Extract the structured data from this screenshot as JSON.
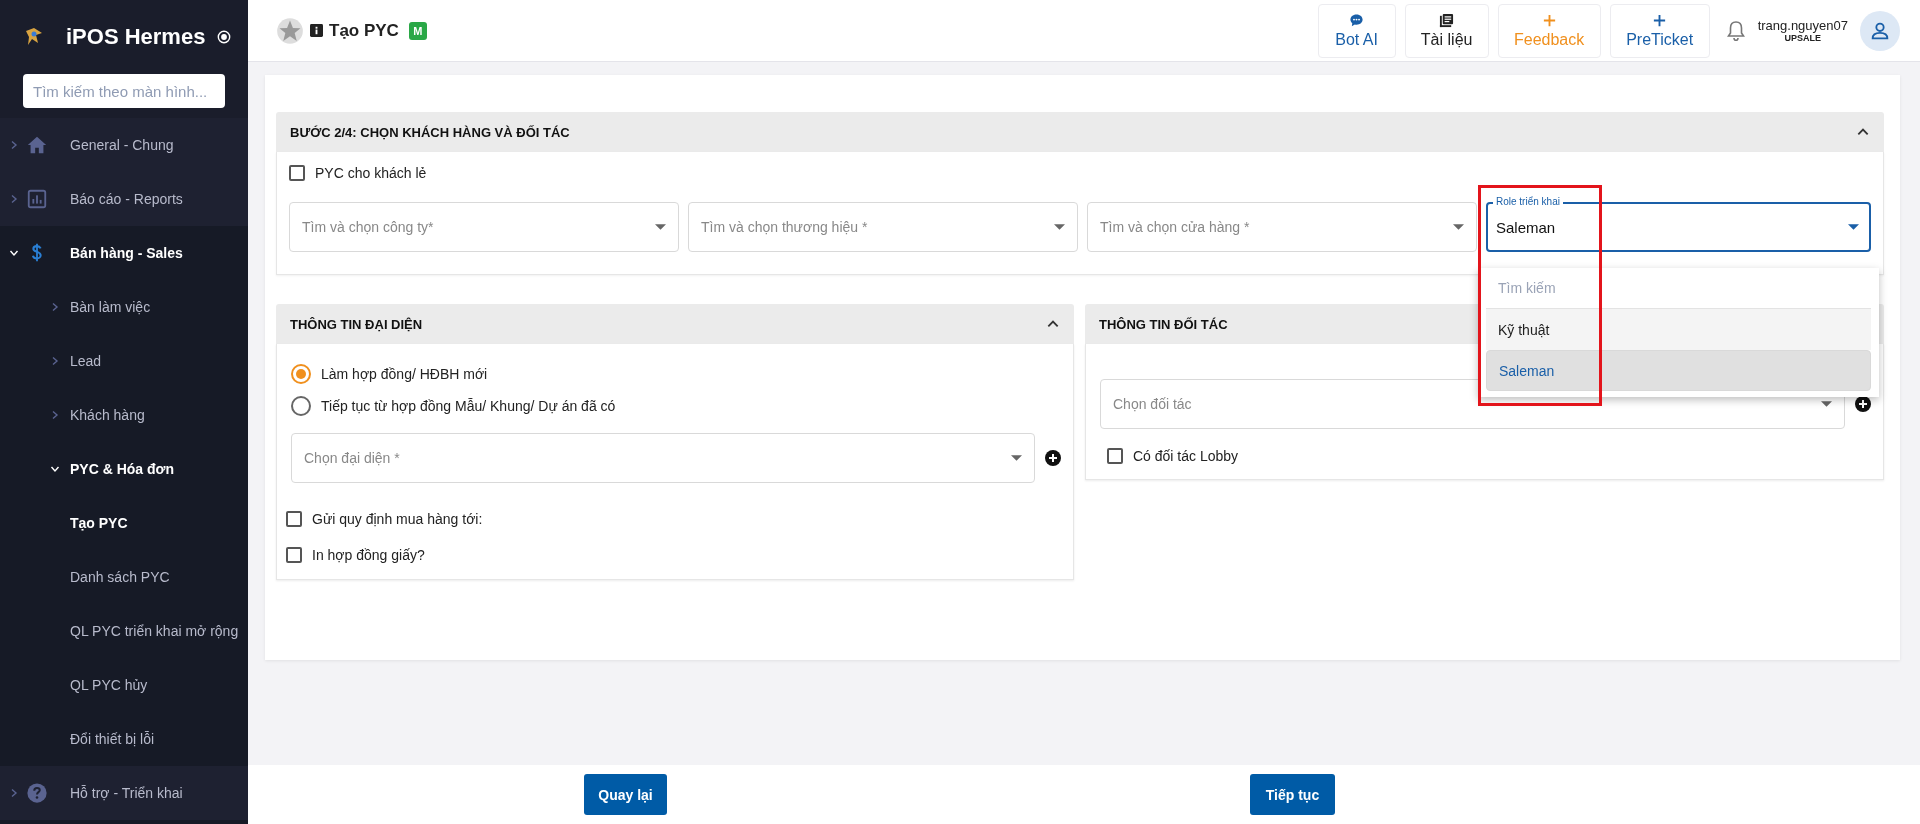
{
  "sidebar": {
    "title": "iPOS Hermes",
    "search": {
      "placeholder": "Tìm kiếm theo màn hình..."
    },
    "items": [
      {
        "label": "General - Chung",
        "expanded": false
      },
      {
        "label": "Báo cáo - Reports",
        "expanded": false
      },
      {
        "label": "Bán hàng - Sales",
        "expanded": true,
        "children": [
          {
            "label": "Bàn làm việc",
            "expanded": false
          },
          {
            "label": "Lead",
            "expanded": false
          },
          {
            "label": "Khách hàng",
            "expanded": false
          },
          {
            "label": "PYC & Hóa đơn",
            "expanded": true,
            "children": [
              {
                "label": "Tạo PYC",
                "selected": true
              },
              {
                "label": "Danh sách PYC",
                "selected": false
              },
              {
                "label": "QL PYC triển khai mở rộng",
                "selected": false
              },
              {
                "label": "QL PYC hủy",
                "selected": false
              },
              {
                "label": "Đổi thiết bị lỗi",
                "selected": false
              }
            ]
          }
        ]
      },
      {
        "label": "Hỗ trợ - Triển khai",
        "expanded": false
      }
    ]
  },
  "header": {
    "title": "Tạo PYC",
    "badge": "M",
    "buttons": [
      {
        "label": "Bot AI",
        "color": "#1a5fa8"
      },
      {
        "label": "Tài liệu",
        "color": "#222222"
      },
      {
        "label": "Feedback",
        "color": "#f0901e"
      },
      {
        "label": "PreTicket",
        "color": "#1a5fa8"
      }
    ],
    "user": {
      "name": "trang.nguyen07",
      "role": "UPSALE"
    }
  },
  "step": {
    "title": "BƯỚC 2/4: CHỌN KHÁCH HÀNG VÀ ĐỐI TÁC",
    "expanded": true,
    "retail_checkbox": {
      "label": "PYC cho khách lẻ",
      "checked": false
    },
    "selects": [
      {
        "placeholder": "Tìm và chọn công ty*"
      },
      {
        "placeholder": "Tìm và chọn thương hiệu *"
      },
      {
        "placeholder": "Tìm và chọn cửa hàng *"
      }
    ],
    "role_select": {
      "label": "Role triển khai",
      "value": "Saleman",
      "open": true,
      "dropdown": {
        "search_placeholder": "Tìm kiếm",
        "options": [
          {
            "label": "Kỹ thuật",
            "selected": false
          },
          {
            "label": "Saleman",
            "selected": true
          }
        ]
      }
    }
  },
  "representative": {
    "title": "THÔNG TIN ĐẠI DIỆN",
    "expanded": true,
    "radios": [
      {
        "label": "Làm hợp đồng/ HĐBH mới",
        "selected": true
      },
      {
        "label": "Tiếp tục từ hợp đồng Mẫu/ Khung/ Dự án đã có",
        "selected": false
      }
    ],
    "select": {
      "placeholder": "Chọn đại diện *"
    },
    "checkboxes": [
      {
        "label": "Gửi quy định mua hàng tới:",
        "checked": false
      },
      {
        "label": "In hợp đồng giấy?",
        "checked": false
      }
    ]
  },
  "partner": {
    "title": "THÔNG TIN ĐỐI TÁC",
    "select": {
      "placeholder": "Chọn đối tác"
    },
    "checkboxes": [
      {
        "label": "Có đối tác Lobby",
        "checked": false
      }
    ]
  },
  "footer": {
    "buttons": [
      "Quay lại",
      "Tiếp tục"
    ]
  }
}
